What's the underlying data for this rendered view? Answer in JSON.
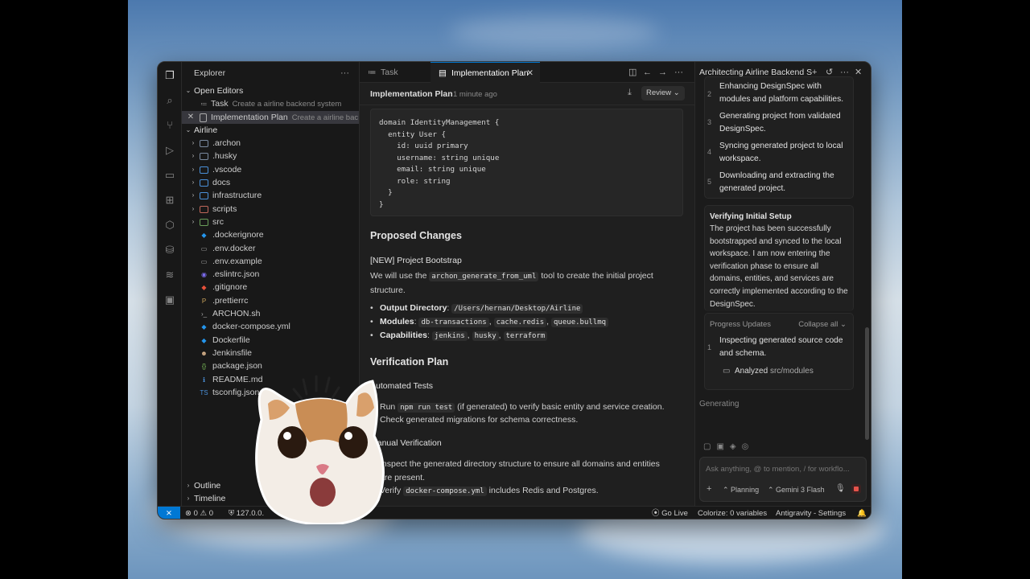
{
  "explorer": {
    "title": "Explorer",
    "open_editors_label": "Open Editors",
    "open_editors": [
      {
        "name": "Task",
        "desc": "Create a airline backend system"
      },
      {
        "name": "Implementation Plan",
        "desc": "Create a airline bac..."
      }
    ],
    "project_label": "Airline",
    "folders": [
      ".archon",
      ".husky",
      ".vscode",
      "docs",
      "infrastructure",
      "scripts",
      "src"
    ],
    "files": [
      ".dockerignore",
      ".env.docker",
      ".env.example",
      ".eslintrc.json",
      ".gitignore",
      ".prettierrc",
      "ARCHON.sh",
      "docker-compose.yml",
      "Dockerfile",
      "Jenkinsfile",
      "package.json",
      "README.md",
      "tsconfig.json"
    ],
    "outline_label": "Outline",
    "timeline_label": "Timeline"
  },
  "tabs": [
    {
      "label": "Task"
    },
    {
      "label": "Implementation Plan"
    }
  ],
  "editor": {
    "title": "Implementation Plan",
    "time": "1 minute ago",
    "review_label": "Review",
    "code": "domain IdentityManagement {\n  entity User {\n    id: uuid primary\n    username: string unique\n    email: string unique\n    role: string\n  }\n}",
    "proposed_heading": "Proposed Changes",
    "new_label": "[NEW] Project Bootstrap",
    "we_will_pre": "We will use the",
    "tool_code": "archon_generate_from_uml",
    "we_will_post": "tool to create the initial project",
    "structure": "structure.",
    "output_label": "Output Directory",
    "output_value": "/Users/hernan/Desktop/Airline",
    "modules_label": "Modules",
    "modules": [
      "db-transactions",
      "cache.redis",
      "queue.bullmq"
    ],
    "capabilities_label": "Capabilities",
    "capabilities": [
      "jenkins",
      "husky",
      "terraform"
    ],
    "verification_heading": "Verification Plan",
    "automated_heading": "Automated Tests",
    "run_pre": "Run",
    "run_code": "npm run test",
    "run_post": "(if generated) to verify basic entity and service creation.",
    "check_migrations": "Check generated migrations for schema correctness.",
    "manual_heading": "Manual Verification",
    "inspect_line1": "Inspect the generated directory structure to ensure all domains and entities",
    "inspect_line2": "are present.",
    "verify_pre": "Verify",
    "verify_code": "docker-compose.yml",
    "verify_post": "includes Redis and Postgres."
  },
  "agent": {
    "title": "Architecting Airline Backend S",
    "steps": [
      {
        "n": "2",
        "text": "Enhancing DesignSpec with modules and platform capabilities."
      },
      {
        "n": "3",
        "text": "Generating project from validated DesignSpec."
      },
      {
        "n": "4",
        "text": "Syncing generated project to local workspace."
      },
      {
        "n": "5",
        "text": "Downloading and extracting the generated project."
      }
    ],
    "verify_title": "Verifying Initial Setup",
    "verify_body": "The project has been successfully bootstrapped and synced to the local workspace. I am now entering the verification phase to ensure all domains, entities, and services are correctly implemented according to the DesignSpec.",
    "progress_label": "Progress Updates",
    "collapse_label": "Collapse all",
    "progress_step": {
      "n": "1",
      "text": "Inspecting generated source code and schema."
    },
    "analyzed_pre": "Analyzed",
    "analyzed_path": "src/modules",
    "generating": "Generating",
    "input_placeholder": "Ask anything, @ to mention, / for workflo...",
    "mode_label": "Planning",
    "model_label": "Gemini 3 Flash"
  },
  "statusbar": {
    "errors": "0",
    "warnings": "0",
    "host": "127.0.0.",
    "go_live": "Go Live",
    "colorize": "Colorize: 0 variables",
    "settings": "Antigravity - Settings"
  },
  "colors": {
    "accent": "#0078d4",
    "stop": "#e5534b"
  }
}
